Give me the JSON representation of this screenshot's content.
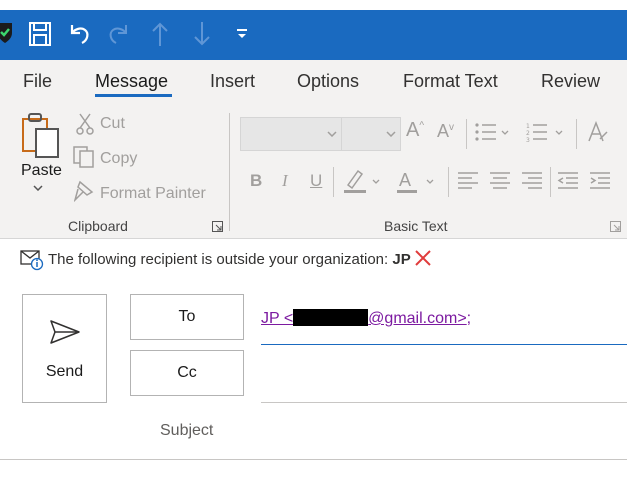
{
  "quick_access": {
    "icons": [
      "shield-check-icon",
      "save-icon",
      "undo-icon",
      "redo-icon",
      "up-arrow-icon",
      "down-arrow-icon",
      "customize-toolbar-icon"
    ]
  },
  "tabs": [
    {
      "label": "File"
    },
    {
      "label": "Message"
    },
    {
      "label": "Insert"
    },
    {
      "label": "Options"
    },
    {
      "label": "Format Text"
    },
    {
      "label": "Review"
    }
  ],
  "ribbon": {
    "clipboard": {
      "paste": "Paste",
      "cut": "Cut",
      "copy": "Copy",
      "format_painter": "Format Painter",
      "group_label": "Clipboard"
    },
    "basic_text": {
      "bold": "B",
      "italic": "I",
      "underline": "U",
      "font_color": "A",
      "group_label": "Basic Text"
    }
  },
  "infobar": {
    "text": "The following recipient is outside your organization: ",
    "name": "JP"
  },
  "compose": {
    "send": "Send",
    "to": "To",
    "cc": "Cc",
    "subject": "Subject",
    "recipient_prefix": "JP <",
    "recipient_suffix": "@gmail.com>",
    "recipient_sep": ";"
  },
  "colors": {
    "accent": "#1a6ac0",
    "link": "#7c1aa0",
    "warning": "#e03c3c"
  }
}
